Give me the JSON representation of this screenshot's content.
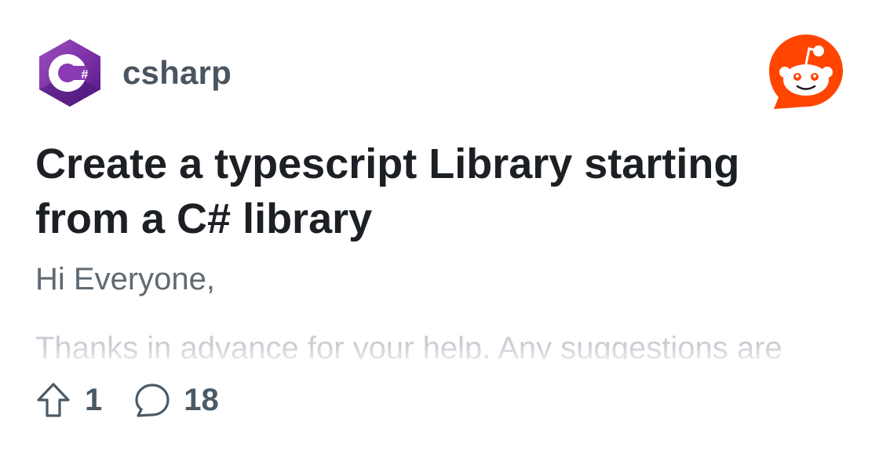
{
  "subreddit": {
    "name": "csharp",
    "icon": "csharp-logo-icon"
  },
  "brand": {
    "logo": "reddit-snoo-logo",
    "color": "#ff4500"
  },
  "post": {
    "title": "Create a typescript Library starting from a C# library",
    "body_first_line": "Hi Everyone,",
    "body_faded_line": "Thanks in advance for your help. Any suggestions are"
  },
  "stats": {
    "upvotes": "1",
    "upvote_icon": "upvote-arrow-icon",
    "comments": "18",
    "comment_icon": "comment-bubble-icon"
  },
  "colors": {
    "title": "#1c2024",
    "meta": "#4a5560",
    "body": "#5f6a73",
    "csharp_purple": "#68217a"
  }
}
